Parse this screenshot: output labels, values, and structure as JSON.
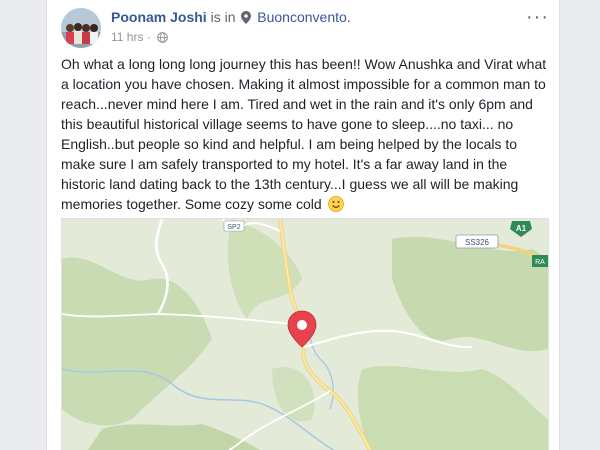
{
  "post": {
    "author": "Poonam Joshi",
    "is_in": "is in",
    "location": "Buonconvento.",
    "time": "11 hrs",
    "separator": "·",
    "text": "Oh what a long long long journey this has been!! Wow Anushka and Virat what a location you have chosen. Making it almost impossible for a common man to reach...never mind here I am. Tired and wet in the rain and it's only 6pm and this beautiful historical village seems to have gone to sleep....no taxi... no English..but people so kind and helpful. I am being helped by the locals to make sure I am safely transported to my hotel. It's a far away land in the historic land dating back to the 13th century...I guess we all will be making memories together. Some cozy some cold",
    "more_label": "···"
  },
  "map": {
    "road_labels": [
      "SS326",
      "A1",
      "RA",
      "SP2"
    ],
    "marker_color": "#e8434d"
  },
  "icons": {
    "pin": "location-pin-icon",
    "globe": "globe-icon",
    "emoji": "smile-emoji-icon",
    "more": "more-options-icon"
  }
}
